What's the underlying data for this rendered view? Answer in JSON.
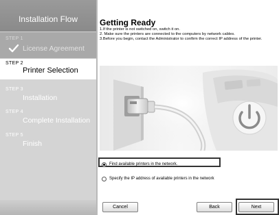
{
  "sidebar": {
    "header": "Installation Flow",
    "steps": [
      {
        "num": "STEP 1",
        "label": "License Agreement",
        "state": "completed",
        "icon": "checkmark-icon"
      },
      {
        "num": "STEP 2",
        "label": "Printer Selection",
        "state": "current"
      },
      {
        "num": "STEP 3",
        "label": "Installation",
        "state": "pending"
      },
      {
        "num": "STEP 4",
        "label": "Complete Installation",
        "state": "pending"
      },
      {
        "num": "STEP 5",
        "label": "Finish",
        "state": "pending"
      }
    ]
  },
  "main": {
    "title": "Getting Ready",
    "instructions": [
      "1.If the printer is not switched on, switch it on.",
      "2. Make sure the printers are connected to the computers by network cables.",
      "3.Before you begin, contact the Administrator to confirm the correct IP address of the printer."
    ],
    "illustration": "network-cable-and-power-button",
    "options": [
      {
        "label": "Find available printers in the network.",
        "selected": true
      },
      {
        "label": "Specify the IP address of available printers in the network",
        "selected": false
      }
    ]
  },
  "buttons": {
    "cancel": "Cancel",
    "back": "Back",
    "next": "Next"
  },
  "colors": {
    "sidebar_bg": "#d4d4d4",
    "sidebar_header_bg": "#8f8f8f",
    "current_step_bg": "#ffffff",
    "highlight_border": "#333333"
  }
}
